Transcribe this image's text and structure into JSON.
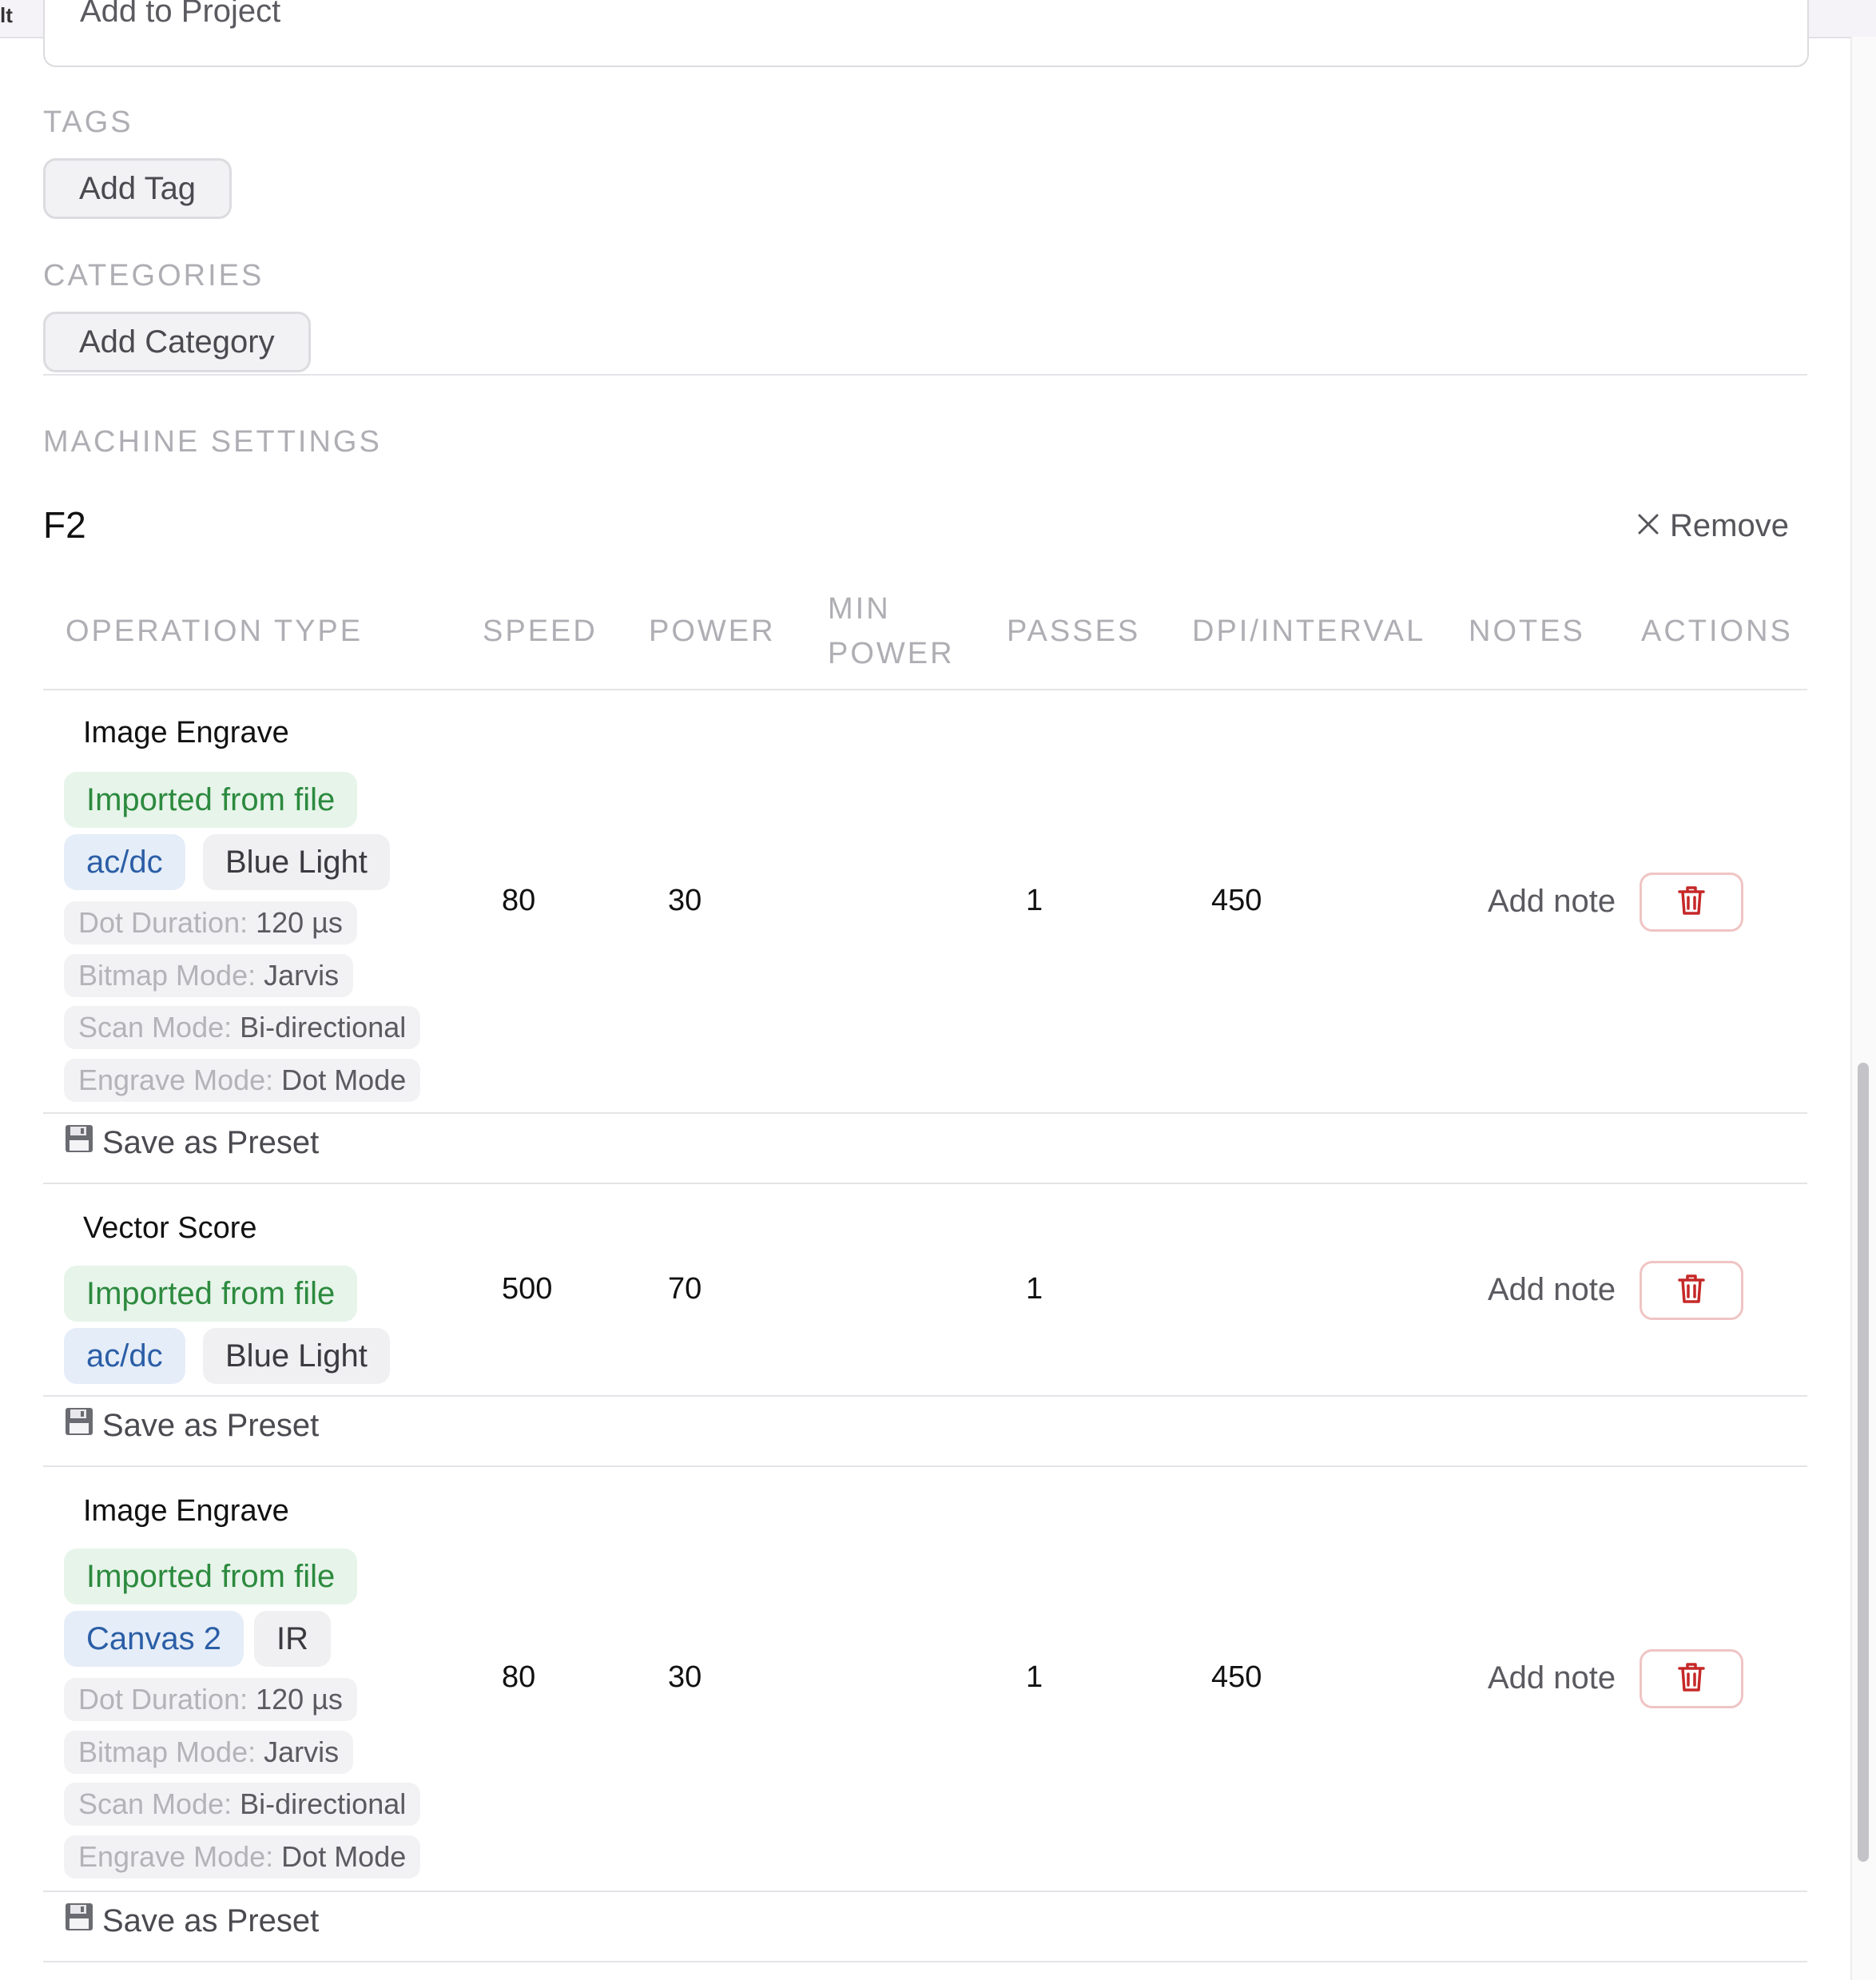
{
  "window": {
    "title_fragment": "lt"
  },
  "project": {
    "add_label": "Add to Project"
  },
  "tags": {
    "heading": "TAGS",
    "add_label": "Add Tag"
  },
  "categories": {
    "heading": "CATEGORIES",
    "add_label": "Add Category"
  },
  "machine_settings": {
    "heading": "MACHINE SETTINGS",
    "machine_name": "F2",
    "remove_label": "Remove",
    "columns": [
      "OPERATION TYPE",
      "SPEED",
      "POWER",
      "MIN POWER",
      "PASSES",
      "DPI/INTERVAL",
      "NOTES",
      "ACTIONS"
    ],
    "rows": [
      {
        "operation": "Image Engrave",
        "source_badge": "Imported from file",
        "badges": [
          "ac/dc",
          "Blue Light"
        ],
        "params": [
          {
            "key": "Dot Duration:",
            "value": "120 µs"
          },
          {
            "key": "Bitmap Mode:",
            "value": "Jarvis"
          },
          {
            "key": "Scan Mode:",
            "value": "Bi-directional"
          },
          {
            "key": "Engrave Mode:",
            "value": "Dot Mode"
          }
        ],
        "speed": "80",
        "power": "30",
        "min_power": "",
        "passes": "1",
        "dpi": "450",
        "note_label": "Add note",
        "preset_label": "Save as Preset"
      },
      {
        "operation": "Vector Score",
        "source_badge": "Imported from file",
        "badges": [
          "ac/dc",
          "Blue Light"
        ],
        "params": [],
        "speed": "500",
        "power": "70",
        "min_power": "",
        "passes": "1",
        "dpi": "",
        "note_label": "Add note",
        "preset_label": "Save as Preset"
      },
      {
        "operation": "Image Engrave",
        "source_badge": "Imported from file",
        "badges": [
          "Canvas 2",
          "IR"
        ],
        "params": [
          {
            "key": "Dot Duration:",
            "value": "120 µs"
          },
          {
            "key": "Bitmap Mode:",
            "value": "Jarvis"
          },
          {
            "key": "Scan Mode:",
            "value": "Bi-directional"
          },
          {
            "key": "Engrave Mode:",
            "value": "Dot Mode"
          }
        ],
        "speed": "80",
        "power": "30",
        "min_power": "",
        "passes": "1",
        "dpi": "450",
        "note_label": "Add note",
        "preset_label": "Save as Preset"
      }
    ]
  },
  "icons": {
    "remove": "close-icon",
    "delete": "trash-icon",
    "preset": "floppy-disk-icon"
  },
  "colors": {
    "source_badge_text": "#2c8a3e",
    "laser_badge_text": "#2b5ea6",
    "delete_icon": "#c62828"
  }
}
